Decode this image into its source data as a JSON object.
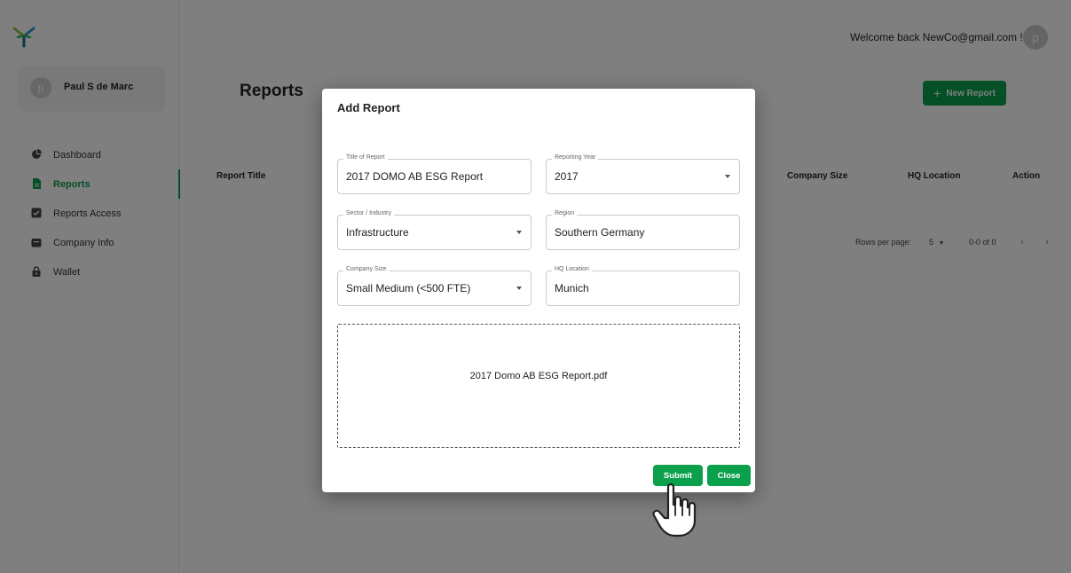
{
  "header": {
    "welcome_text": "Welcome back NewCo@gmail.com !",
    "avatar_letter": "p"
  },
  "sidebar": {
    "profile": {
      "avatar_letter": "p",
      "name": "Paul S de Marc"
    },
    "items": [
      {
        "label": "Dashboard",
        "icon": "pie-chart-icon",
        "active": false
      },
      {
        "label": "Reports",
        "icon": "document-icon",
        "active": true
      },
      {
        "label": "Reports Access",
        "icon": "checkbox-icon",
        "active": false
      },
      {
        "label": "Company Info",
        "icon": "briefcase-icon",
        "active": false
      },
      {
        "label": "Wallet",
        "icon": "lock-icon",
        "active": false
      }
    ]
  },
  "main": {
    "page_title": "Reports",
    "new_report_label": "New Report",
    "table_headers": [
      "Report Title",
      "Company Size",
      "HQ Location",
      "Action"
    ],
    "pagination": {
      "rows_per_page_label": "Rows per page:",
      "rows_per_page_value": "5",
      "range": "0-0 of 0"
    }
  },
  "modal": {
    "title": "Add Report",
    "fields": {
      "title_of_report": {
        "label": "Title of Report",
        "value": "2017 DOMO AB ESG Report"
      },
      "reporting_year": {
        "label": "Reporting Year",
        "value": "2017"
      },
      "sector": {
        "label": "Sector / Industry",
        "value": "Infrastructure"
      },
      "region": {
        "label": "Region",
        "value": "Southern Germany"
      },
      "company_size": {
        "label": "Company Size",
        "value": "Small Medium (<500 FTE)"
      },
      "hq_location": {
        "label": "HQ Location",
        "value": "Munich"
      }
    },
    "uploaded_file": "2017 Domo AB ESG Report.pdf",
    "submit_label": "Submit",
    "close_label": "Close"
  },
  "colors": {
    "accent_green": "#0aa04c",
    "overlay": "rgba(0,0,0,0.5)"
  }
}
